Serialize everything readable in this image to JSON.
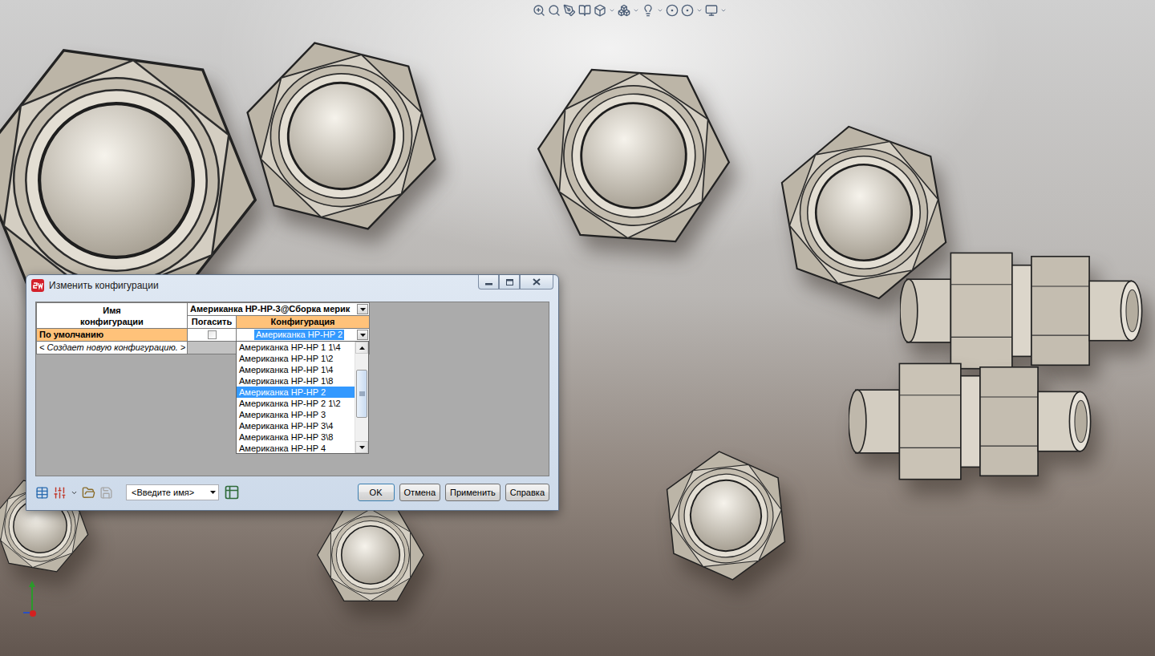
{
  "window": {
    "title": "Изменить конфигурации"
  },
  "table": {
    "name_header": [
      "Имя",
      "конфигурации"
    ],
    "component_header": "Американка НР-НР-3@Сборка мерик",
    "columns": [
      {
        "label": "Погасить",
        "selected": false
      },
      {
        "label": "Конфигурация",
        "selected": true
      }
    ],
    "rows": [
      {
        "kind": "config",
        "name": "По умолчанию",
        "selected": true,
        "suppressed": false,
        "configuration": "Американка НР-НР 2"
      },
      {
        "kind": "new",
        "name": "< Создает новую конфигурацию. >",
        "selected": false
      }
    ]
  },
  "dropdown": {
    "open": true,
    "scroll_level": 0.4,
    "items": [
      {
        "label": "Американка НР-НР 1 1\\4",
        "selected": false
      },
      {
        "label": "Американка НР-НР 1\\2",
        "selected": false
      },
      {
        "label": "Американка НР-НР 1\\4",
        "selected": false
      },
      {
        "label": "Американка НР-НР 1\\8",
        "selected": false
      },
      {
        "label": "Американка НР-НР 2",
        "selected": true
      },
      {
        "label": "Американка НР-НР 2 1\\2",
        "selected": false
      },
      {
        "label": "Американка НР-НР 3",
        "selected": false
      },
      {
        "label": "Американка НР-НР 3\\4",
        "selected": false
      },
      {
        "label": "Американка НР-НР 3\\8",
        "selected": false
      },
      {
        "label": "Американка НР-НР 4",
        "selected": false
      }
    ]
  },
  "footer": {
    "name_field": {
      "placeholder": "<Введите имя>"
    },
    "save_disabled": true,
    "buttons": [
      {
        "label": "OK",
        "default": true
      },
      {
        "label": "Отмена",
        "default": false
      },
      {
        "label": "Применить",
        "default": false
      },
      {
        "label": "Справка",
        "default": false
      }
    ]
  }
}
